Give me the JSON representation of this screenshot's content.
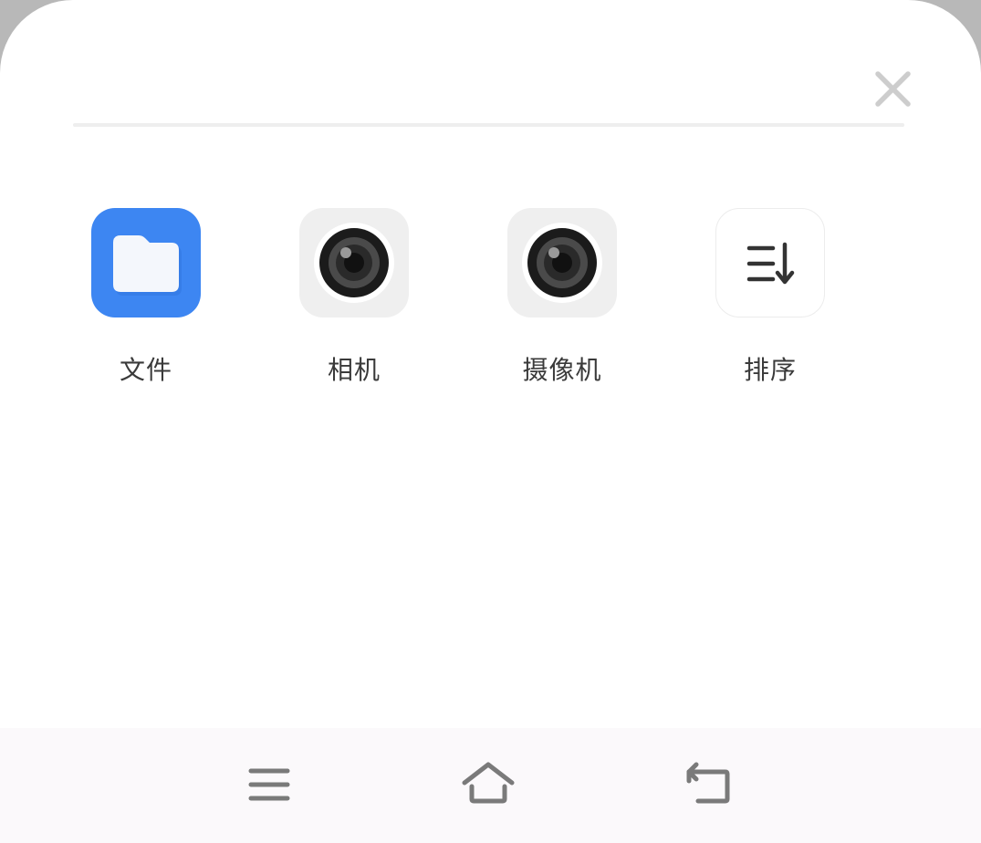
{
  "dialog": {
    "close_icon": "close-icon"
  },
  "apps": [
    {
      "label": "文件",
      "icon": "folder-icon",
      "color": "#3d86f2"
    },
    {
      "label": "相机",
      "icon": "camera-lens-icon",
      "color": "#efefef"
    },
    {
      "label": "摄像机",
      "icon": "camera-lens-icon",
      "color": "#efefef"
    },
    {
      "label": "排序",
      "icon": "sort-icon",
      "color": "#ffffff"
    }
  ],
  "navbar": {
    "buttons": [
      {
        "icon": "menu-icon"
      },
      {
        "icon": "home-icon"
      },
      {
        "icon": "back-icon"
      }
    ]
  }
}
